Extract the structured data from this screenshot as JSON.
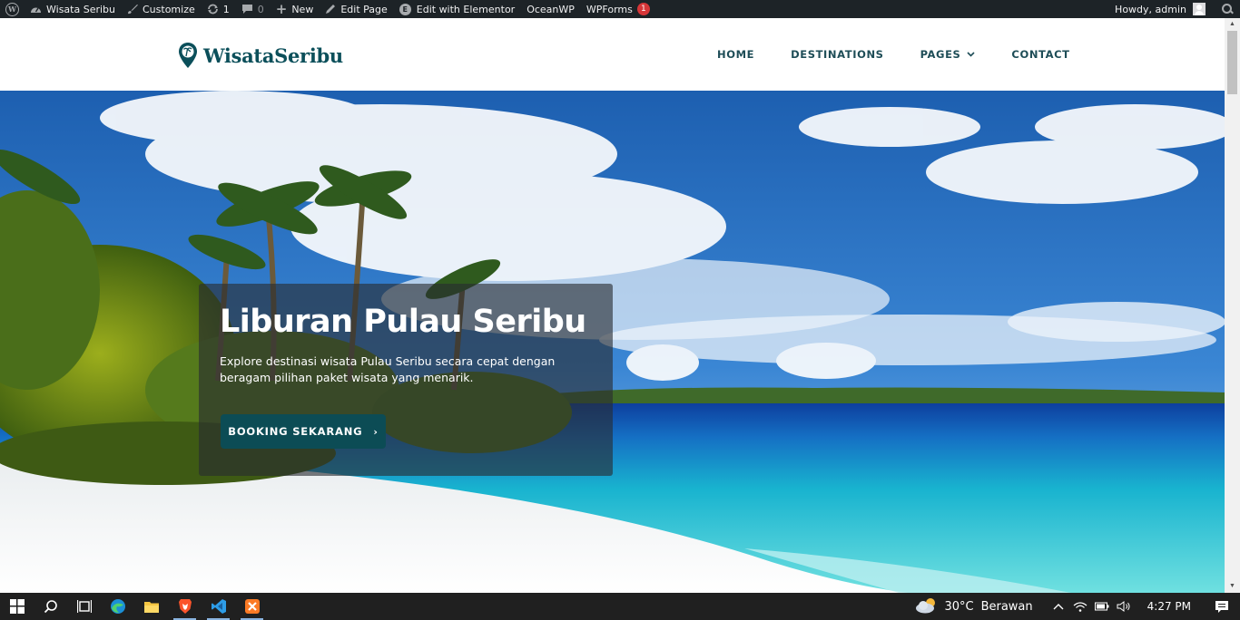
{
  "adminbar": {
    "site_name": "Wisata Seribu",
    "customize": "Customize",
    "updates_count": "1",
    "comments_count": "0",
    "new": "New",
    "edit_page": "Edit Page",
    "edit_elementor": "Edit with Elementor",
    "oceanwp": "OceanWP",
    "wpforms": "WPForms",
    "wpforms_badge": "1",
    "howdy": "Howdy, admin"
  },
  "header": {
    "logo_text": "WisataSeribu",
    "nav": [
      {
        "label": "HOME"
      },
      {
        "label": "DESTINATIONS"
      },
      {
        "label": "PAGES"
      },
      {
        "label": "CONTACT"
      }
    ]
  },
  "hero": {
    "title": "Liburan Pulau Seribu",
    "description": "Explore destinasi wisata Pulau Seribu secara cepat dengan beragam pilihan paket wisata yang menarik.",
    "button_label": "BOOKING SEKARANG",
    "button_arrow": "›"
  },
  "taskbar": {
    "apps": [
      "start",
      "search",
      "task-view",
      "edge",
      "file-explorer",
      "brave",
      "vscode",
      "xampp"
    ],
    "weather_temp": "30°C",
    "weather_desc": "Berawan",
    "clock": "4:27 PM"
  },
  "colors": {
    "brand": "#0b4f5a",
    "button": "#0c4c55",
    "adminbar": "#1d2327",
    "taskbar": "#202020"
  }
}
